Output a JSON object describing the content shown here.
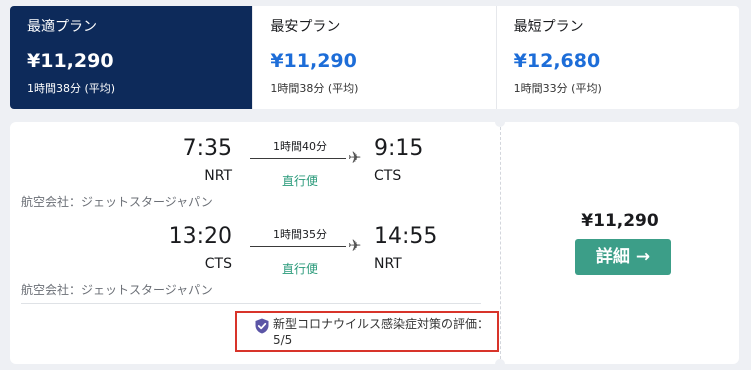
{
  "tabs": [
    {
      "title": "最適プラン",
      "price": "¥11,290",
      "duration": "1時間38分 (平均)",
      "active": true
    },
    {
      "title": "最安プラン",
      "price": "¥11,290",
      "duration": "1時間38分 (平均)",
      "active": false
    },
    {
      "title": "最短プラン",
      "price": "¥12,680",
      "duration": "1時間33分 (平均)",
      "active": false
    }
  ],
  "flight": {
    "legs": [
      {
        "dep_time": "7:35",
        "dep_airport": "NRT",
        "arr_time": "9:15",
        "arr_airport": "CTS",
        "duration": "1時間40分",
        "direct": "直行便",
        "airline": "航空会社：ジェットスタージャパン"
      },
      {
        "dep_time": "13:20",
        "dep_airport": "CTS",
        "arr_time": "14:55",
        "arr_airport": "NRT",
        "duration": "1時間35分",
        "direct": "直行便",
        "airline": "航空会社：ジェットスタージャパン"
      }
    ],
    "covid_rating": "新型コロナウイルス感染症対策の評価：5/5",
    "price": "¥11,290",
    "details_button": "詳細 →"
  },
  "colors": {
    "active_tab": "#0d2a5a",
    "price_blue": "#1d6dd8",
    "button_green": "#3c9e88",
    "highlight_red": "#d8342a"
  },
  "icons": {
    "plane": "airplane-icon",
    "shield": "shield-check-icon"
  }
}
